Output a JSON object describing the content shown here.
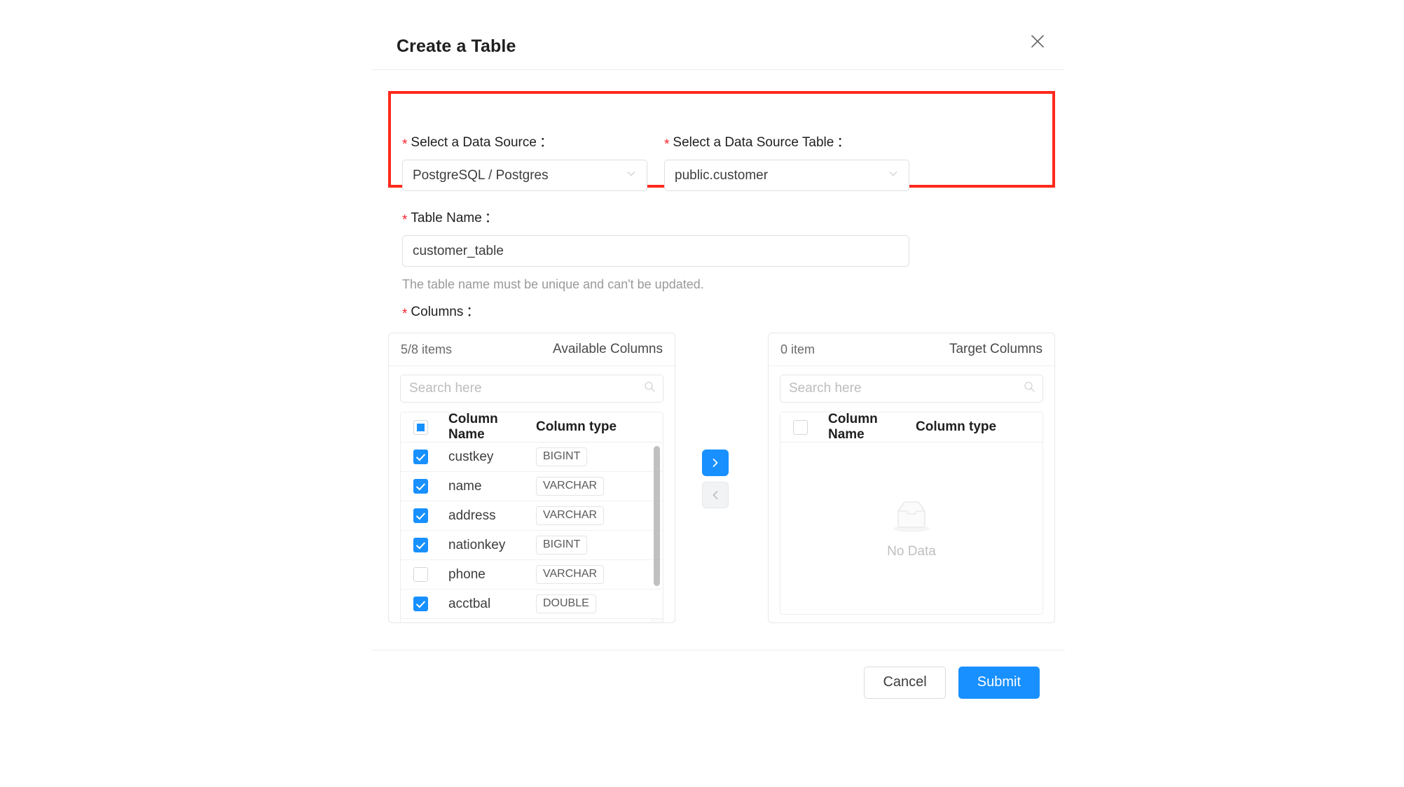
{
  "dialog": {
    "title": "Create a Table",
    "close_icon": "close-icon"
  },
  "form": {
    "data_source": {
      "label": "Select a Data Source",
      "required_marker": "*",
      "colon": "：",
      "value": "PostgreSQL / Postgres"
    },
    "data_source_table": {
      "label": "Select a Data Source Table",
      "required_marker": "*",
      "colon": "：",
      "value": "public.customer"
    },
    "table_name": {
      "label": "Table Name",
      "required_marker": "*",
      "colon": "：",
      "value": "customer_table",
      "helper": "The table name must be unique and can't be updated."
    },
    "columns": {
      "label": "Columns",
      "required_marker": "*",
      "colon": "："
    }
  },
  "transfer": {
    "available": {
      "count_text": "5/8 items",
      "title": "Available Columns",
      "search_placeholder": "Search here",
      "header_checkbox_state": "indeterminate",
      "columns": [
        "Column Name",
        "Column type"
      ],
      "rows": [
        {
          "checked": true,
          "name": "custkey",
          "type": "BIGINT"
        },
        {
          "checked": true,
          "name": "name",
          "type": "VARCHAR"
        },
        {
          "checked": true,
          "name": "address",
          "type": "VARCHAR"
        },
        {
          "checked": true,
          "name": "nationkey",
          "type": "BIGINT"
        },
        {
          "checked": false,
          "name": "phone",
          "type": "VARCHAR"
        },
        {
          "checked": true,
          "name": "acctbal",
          "type": "DOUBLE"
        }
      ]
    },
    "target": {
      "count_text": "0 item",
      "title": "Target Columns",
      "search_placeholder": "Search here",
      "header_checkbox_state": "unchecked",
      "columns": [
        "Column Name",
        "Column type"
      ],
      "rows": [],
      "empty_text": "No Data",
      "empty_icon": "empty-inbox-icon"
    },
    "move_right_icon": "chevron-right-icon",
    "move_left_icon": "chevron-left-icon"
  },
  "footer": {
    "cancel_label": "Cancel",
    "submit_label": "Submit"
  },
  "colors": {
    "accent": "#1890ff",
    "required": "#f5222d",
    "highlight": "#ff2a1c",
    "text": "#1f1f1f",
    "muted": "#9a9a9a"
  }
}
